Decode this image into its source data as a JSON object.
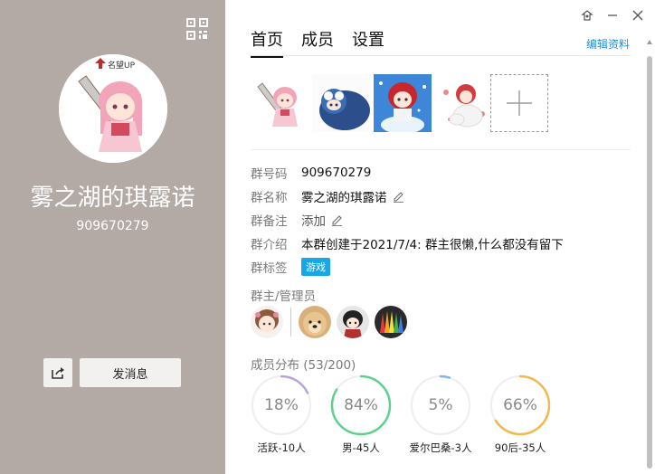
{
  "profile": {
    "name": "雾之湖的琪露诺",
    "id": "909670279",
    "avatar_icon": "anime-girl-sword-avatar",
    "send_label": "发消息"
  },
  "tabs": [
    {
      "label": "首页",
      "active": true
    },
    {
      "label": "成员",
      "active": false
    },
    {
      "label": "设置",
      "active": false
    }
  ],
  "edit_profile_label": "编辑资料",
  "info": {
    "number_label": "群号码",
    "number_value": "909670279",
    "name_label": "群名称",
    "name_value": "雾之湖的琪露诺",
    "note_label": "群备注",
    "note_value": "添加",
    "intro_label": "群介绍",
    "intro_value": "本群创建于2021/7/4:  群主很懒,什么都没有留下",
    "tag_label": "群标签",
    "tag_value": "游戏"
  },
  "admins_title": "群主/管理员",
  "distribution": {
    "title": "成员分布 (53/200)",
    "items": [
      {
        "percent": 18,
        "text": "18%",
        "label": "活跃-10人",
        "color": "#b9a3d9"
      },
      {
        "percent": 84,
        "text": "84%",
        "label": "男-45人",
        "color": "#5fcf8e"
      },
      {
        "percent": 5,
        "text": "5%",
        "label": "爱尔巴桑-3人",
        "color": "#7fb6f0"
      },
      {
        "percent": 66,
        "text": "66%",
        "label": "90后-35人",
        "color": "#f2b84a"
      }
    ]
  },
  "colors": {
    "left_pane": "#b3a9a5",
    "accent_link": "#1d8fe0",
    "tag": "#18a7e6"
  }
}
